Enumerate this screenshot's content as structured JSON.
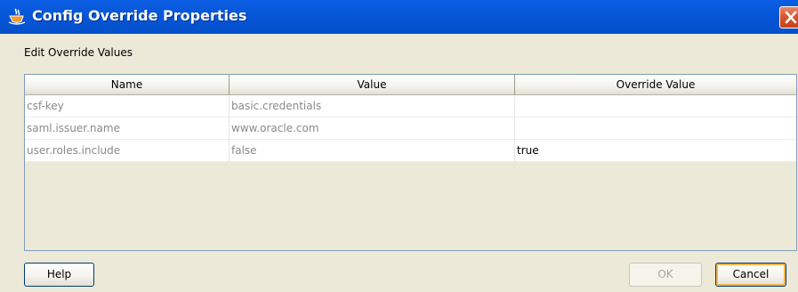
{
  "window": {
    "title": "Config Override Properties",
    "colors": {
      "titlebar": "#0553d2",
      "close": "#d8552f",
      "dialog_bg": "#ece9d8"
    },
    "icons": {
      "app": "oracle-coffee-cup-icon",
      "close": "close-icon"
    }
  },
  "content": {
    "section_label": "Edit Override Values"
  },
  "table": {
    "columns": [
      "Name",
      "Value",
      "Override Value"
    ],
    "rows": [
      {
        "name": "csf-key",
        "value": "basic.credentials",
        "override": ""
      },
      {
        "name": "saml.issuer.name",
        "value": "www.oracle.com",
        "override": ""
      },
      {
        "name": "user.roles.include",
        "value": "false",
        "override": "true"
      }
    ]
  },
  "buttons": {
    "help": "Help",
    "ok": "OK",
    "cancel": "Cancel"
  }
}
